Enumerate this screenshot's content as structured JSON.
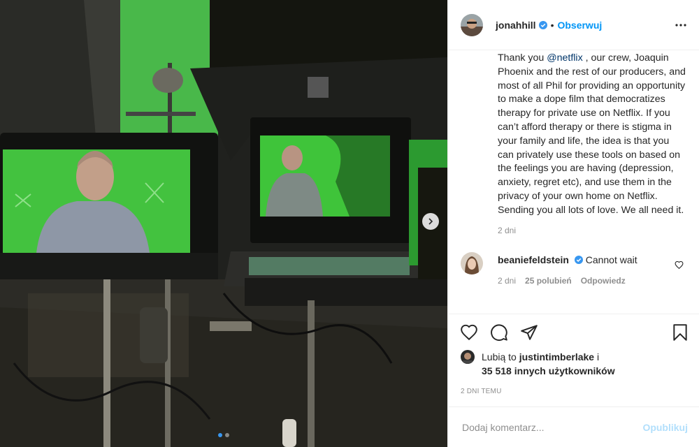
{
  "post": {
    "username": "jonahhill",
    "separator": "•",
    "follow_label": "Obserwuj",
    "caption_before": "Thank you ",
    "caption_mention": "@netflix",
    "caption_after": " , our crew, Joaquin Phoenix and the rest of our producers, and most of all Phil for providing an opportunity to make a dope film that democratizes therapy for private use on Netflix. If you can’t afford therapy or there is stigma in your family and life, the idea is that you can privately use these tools on based on the feelings you are having (depression, anxiety, regret etc), and use them in the privacy of your own home on Netflix. Sending you all lots of love. We all need it.",
    "caption_time": "2 dni"
  },
  "comment": {
    "username": "beaniefeldstein",
    "text": "Cannot wait",
    "time": "2 dni",
    "likes": "25 polubień",
    "reply_label": "Odpowiedz"
  },
  "likes": {
    "prefix": "Lubią to ",
    "user": "justintimberlake",
    "suffix": " i",
    "others": "35 518 innych użytkowników"
  },
  "timestamp": "2 DNI TEMU",
  "add_comment": {
    "placeholder": "Dodaj komentarz...",
    "publish_label": "Opublikuj"
  },
  "carousel": {
    "count": 2,
    "active": 0
  },
  "colors": {
    "accent": "#0095f6",
    "verified": "#3897f0",
    "chroma_green": "#3fc43a"
  }
}
